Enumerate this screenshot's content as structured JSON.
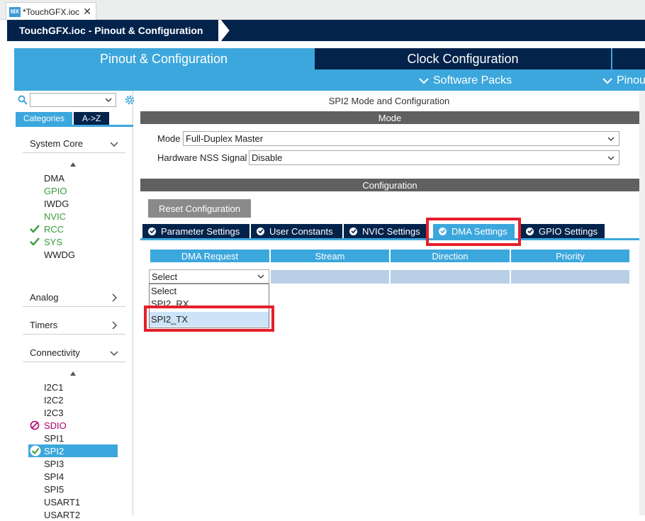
{
  "editor": {
    "app_badge": "MX",
    "file_tab": "*TouchGFX.ioc"
  },
  "breadcrumb": "TouchGFX.ioc - Pinout & Configuration",
  "main_tabs": {
    "pinout": "Pinout & Configuration",
    "clock": "Clock Configuration",
    "software_packs": "Software Packs",
    "pinout_menu": "Pinout"
  },
  "left": {
    "categories": "Categories",
    "az": "A->Z",
    "system_core": {
      "label": "System Core",
      "items": [
        {
          "label": "DMA",
          "status": "none"
        },
        {
          "label": "GPIO",
          "status": "green"
        },
        {
          "label": "IWDG",
          "status": "none"
        },
        {
          "label": "NVIC",
          "status": "green"
        },
        {
          "label": "RCC",
          "status": "check"
        },
        {
          "label": "SYS",
          "status": "check"
        },
        {
          "label": "WWDG",
          "status": "none"
        }
      ]
    },
    "analog": "Analog",
    "timers": "Timers",
    "connectivity": {
      "label": "Connectivity",
      "items": [
        {
          "label": "I2C1",
          "status": "none"
        },
        {
          "label": "I2C2",
          "status": "none"
        },
        {
          "label": "I2C3",
          "status": "none"
        },
        {
          "label": "SDIO",
          "status": "blocked"
        },
        {
          "label": "SPI1",
          "status": "none"
        },
        {
          "label": "SPI2",
          "status": "selected"
        },
        {
          "label": "SPI3",
          "status": "none"
        },
        {
          "label": "SPI4",
          "status": "none"
        },
        {
          "label": "SPI5",
          "status": "none"
        },
        {
          "label": "USART1",
          "status": "none"
        },
        {
          "label": "USART2",
          "status": "none"
        }
      ]
    }
  },
  "right": {
    "title": "SPI2 Mode and Configuration",
    "mode_header": "Mode",
    "mode_label": "Mode",
    "mode_value": "Full-Duplex Master",
    "nss_label": "Hardware NSS Signal",
    "nss_value": "Disable",
    "config_header": "Configuration",
    "reset_button": "Reset Configuration",
    "tabs": [
      "Parameter Settings",
      "User Constants",
      "NVIC Settings",
      "DMA Settings",
      "GPIO Settings"
    ],
    "active_tab": "DMA Settings",
    "dma_columns": [
      "DMA Request",
      "Stream",
      "Direction",
      "Priority"
    ],
    "select_value": "Select",
    "dropdown_options": [
      "Select",
      "SPI2_RX",
      "SPI2_TX"
    ],
    "highlighted_option": "SPI2_TX"
  },
  "colors": {
    "navy": "#03234b",
    "accent": "#3ca7dc",
    "highlight_red": "#e51f2a",
    "ok_green": "#3a9a3a"
  }
}
